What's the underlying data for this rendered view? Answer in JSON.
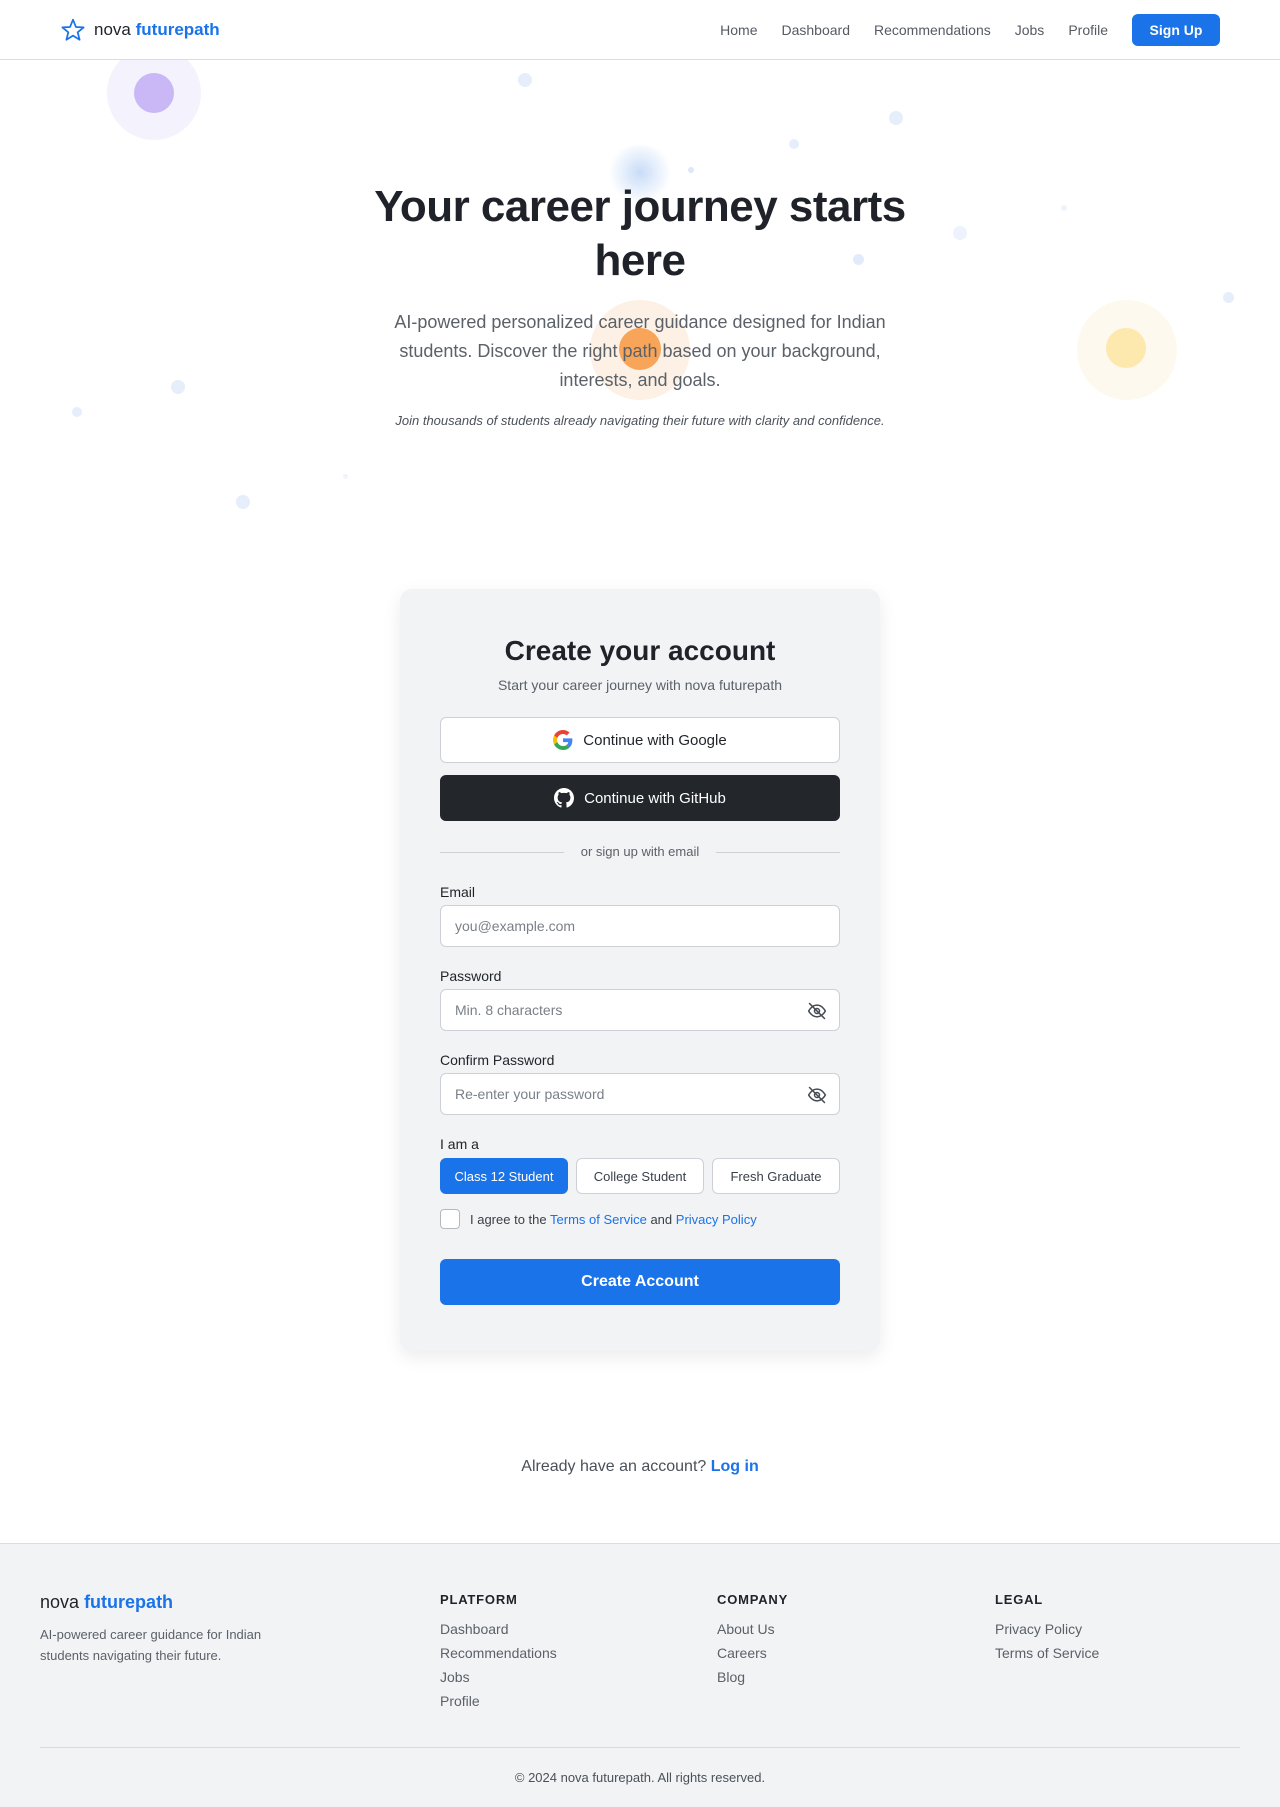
{
  "nav": {
    "brand_prefix": "nova",
    "brand_accent": "futurepath",
    "links": [
      "Home",
      "Dashboard",
      "Recommendations",
      "Jobs",
      "Profile"
    ],
    "signup_label": "Sign Up"
  },
  "hero": {
    "title": "Your career journey starts here",
    "subtitle": "AI-powered personalized career guidance designed for Indian students. Discover the right path based on your background, interests, and goals.",
    "note": "Join thousands of students already navigating their future with clarity and confidence."
  },
  "signup": {
    "title": "Create your account",
    "subtitle": "Start your career journey with nova futurepath",
    "google_label": "Continue with Google",
    "github_label": "Continue with GitHub",
    "divider_text": "or sign up with email",
    "email_label": "Email",
    "email_placeholder": "you@example.com",
    "password_label": "Password",
    "password_placeholder": "Min. 8 characters",
    "confirm_label": "Confirm Password",
    "confirm_placeholder": "Re-enter your password",
    "role_label": "I am a",
    "roles": [
      {
        "label": "Class 12 Student",
        "selected": true
      },
      {
        "label": "College Student",
        "selected": false
      },
      {
        "label": "Fresh Graduate",
        "selected": false
      }
    ],
    "agree_prefix": "I agree to the",
    "terms_link": "Terms of Service",
    "agree_and": "and",
    "privacy_link": "Privacy Policy",
    "agree_checked": false,
    "submit_label": "Create Account"
  },
  "login": {
    "prompt": "Already have an account?",
    "link": "Log in"
  },
  "footer": {
    "brand_prefix": "nova",
    "brand_accent": "futurepath",
    "description": "AI-powered career guidance for Indian students navigating their future.",
    "platform": {
      "heading": "PLATFORM",
      "links": [
        "Dashboard",
        "Recommendations",
        "Jobs",
        "Profile"
      ]
    },
    "company": {
      "heading": "COMPANY",
      "links": [
        "About Us",
        "Careers",
        "Blog"
      ]
    },
    "legal": {
      "heading": "LEGAL",
      "links": [
        "Privacy Policy",
        "Terms of Service"
      ]
    },
    "copyright": "© 2024 nova futurepath. All rights reserved."
  },
  "colors": {
    "accent": "#1a73e8",
    "github_dark": "#23272c",
    "card_bg": "#f2f3f5"
  }
}
